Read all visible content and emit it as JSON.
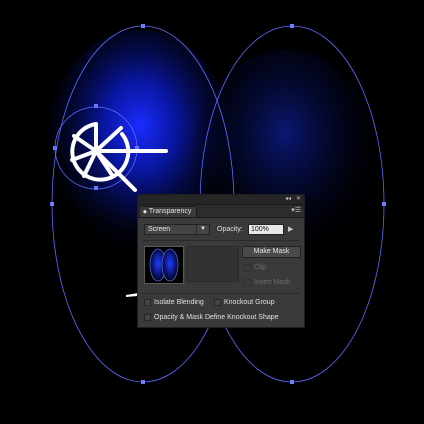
{
  "panel": {
    "title": "Transparency",
    "collapse_icon": "◂◂",
    "close_icon": "✕",
    "menu_icon": "▾☰",
    "blend_mode": "Screen",
    "opacity_label": "Opacity:",
    "opacity_value": "100%",
    "make_mask_label": "Make Mask",
    "clip_label": "Clip",
    "invert_mask_label": "Invert Mask",
    "isolate_blending_label": "Isolate Blending",
    "knockout_group_label": "Knockout Group",
    "opacity_mask_label": "Opacity & Mask Define Knockout Shape"
  },
  "colors": {
    "background": "#000000",
    "selection": "#5b6cff",
    "glow": "#1030ff",
    "icon": "#ffffff"
  },
  "icons": {
    "orange_slice": "citrus-slice-icon"
  }
}
